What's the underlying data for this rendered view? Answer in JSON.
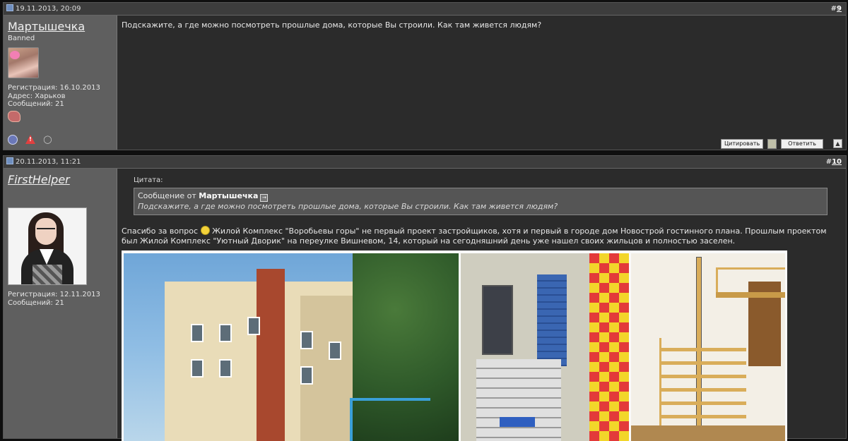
{
  "posts": [
    {
      "date": "19.11.2013, 20:09",
      "number_prefix": "#",
      "number": "9",
      "user": {
        "name": "Мартышечка",
        "title": "Banned",
        "registration": "Регистрация: 16.10.2013",
        "address": "Адрес: Харьков",
        "messages": "Сообщений: 21"
      },
      "message": "Подскажите, а где можно посмотреть прошлые дома, которые Вы строили. Как там живется людям?",
      "buttons": {
        "quote": "Цитировать",
        "reply": "Ответить"
      }
    },
    {
      "date": "20.11.2013, 11:21",
      "number_prefix": "#",
      "number": "10",
      "user": {
        "name": "FirstHelper",
        "registration": "Регистрация: 12.11.2013",
        "messages": "Сообщений: 21"
      },
      "quote": {
        "label": "Цитата:",
        "from_prefix": "Сообщение от ",
        "from_user": "Мартышечка",
        "text": "Подскажите, а где можно посмотреть прошлые дома, которые Вы строили. Как там живется людям?"
      },
      "message_part1": "Спасибо за вопрос ",
      "message_part2": " Жилой Комплекс \"Воробьевы горы\" не первый проект застройщиков, хотя и первый в городе дом Новострой гостинного плана. Прошлым проектом был Жилой Комплекс \"Уютный Дворик\" на переулке Вишневом, 14, который на сегодняшний день уже нашел своих жильцов и полностью заселен."
    }
  ],
  "icons": {
    "date": "post-date-icon",
    "online": "online-status-icon",
    "report": "report-icon",
    "attachment": "attachment-icon",
    "reputation": "reputation-icon",
    "smile": "smile-icon",
    "view_post": "view-post-icon",
    "multiquote": "multiquote-icon",
    "top": "scroll-top-icon"
  },
  "colors": {
    "background": "#0f0f0f",
    "post_bg": "#2b2b2b",
    "sidebar_bg": "#5f5f5f",
    "header_bg": "#3d3d3d",
    "quote_bg": "#555555"
  }
}
